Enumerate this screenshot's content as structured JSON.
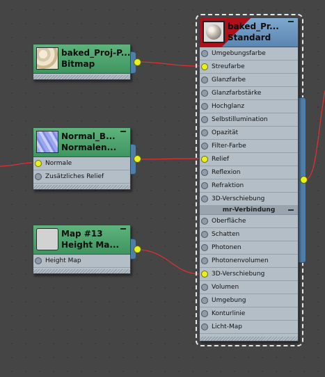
{
  "nodes": {
    "baked_proj": {
      "title": "baked_Proj-P...",
      "subtitle": "Bitmap"
    },
    "normal_bump": {
      "title": "Normal_B...",
      "subtitle": "Normalen...",
      "slots": [
        "Normale",
        "Zusätzliches Relief"
      ]
    },
    "map13": {
      "title": "Map #13",
      "subtitle": "Height Ma...",
      "slots": [
        "Height Map"
      ]
    },
    "standard": {
      "title": "baked_Pr...",
      "subtitle": "Standard",
      "slots": [
        "Umgebungsfarbe",
        "Streufarbe",
        "Glanzfarbe",
        "Glanzfarbstärke",
        "Hochglanz",
        "Selbstillumination",
        "Opazität",
        "Filter-Farbe",
        "Relief",
        "Reflexion",
        "Refraktion",
        "3D-Verschiebung"
      ],
      "section": "mr-Verbindung",
      "mr_slots": [
        "Oberfläche",
        "Schatten",
        "Photonen",
        "Photonenvolumen",
        "3D-Verschiebung",
        "Volumen",
        "Umgebung",
        "Konturlinie",
        "Licht-Map"
      ]
    }
  },
  "colors": {
    "node_header_green": "#4fa46c",
    "node_body": "#b4bec6",
    "wire": "#e03030",
    "port_active": "#e8f21a",
    "output_bar": "#4f7fa8"
  }
}
